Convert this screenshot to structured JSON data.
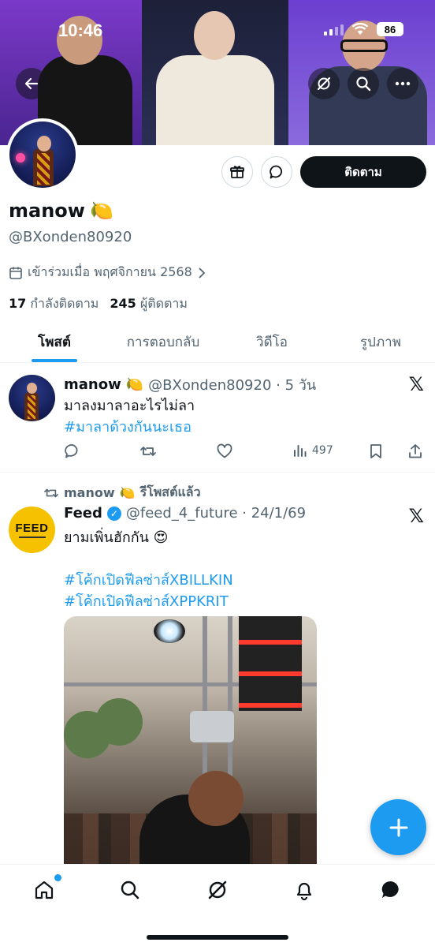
{
  "status_bar": {
    "time": "10:46",
    "battery": "86"
  },
  "banner": {
    "icons": [
      "back-arrow-icon",
      "grok-icon",
      "search-icon",
      "more-icon"
    ]
  },
  "profile": {
    "name": "manow",
    "name_emoji": "🍋",
    "handle": "@BXonden80920",
    "joined": "เข้าร่วมเมื่อ พฤศจิกายน 2568",
    "following_count": "17",
    "following_label": "กำลังติดตาม",
    "followers_count": "245",
    "followers_label": "ผู้ติดตาม",
    "follow_button": "ติดตาม"
  },
  "tabs": [
    {
      "label": "โพสต์",
      "active": true
    },
    {
      "label": "การตอบกลับ",
      "active": false
    },
    {
      "label": "วิดีโอ",
      "active": false
    },
    {
      "label": "รูปภาพ",
      "active": false
    }
  ],
  "post1": {
    "name": "manow",
    "emoji": "🍋",
    "handle_time": "@BXonden80920 · 5 วัน",
    "text": "มาลงมาลาอะไรไม่ลา",
    "hashtag": "#มาลาด้วงกันนะเธอ",
    "views": "497"
  },
  "post2": {
    "repost_by": "manow",
    "repost_emoji": "🍋",
    "repost_label": "รีโพสต์แล้ว",
    "name": "Feed",
    "handle_time": "@feed_4_future · 24/1/69",
    "text": "ยามเพิ่นฮักกัน 😍",
    "hashtag1": "#โค้กเปิดฟีลซ่าส์XBILLKIN",
    "hashtag2": "#โค้กเปิดฟีลซ่าส์XPPKRIT",
    "avatar_logo": "FEED"
  },
  "colors": {
    "accent": "#1d9bf0",
    "text": "#0f1419",
    "muted": "#536471",
    "follow_bg": "#0f1419"
  }
}
